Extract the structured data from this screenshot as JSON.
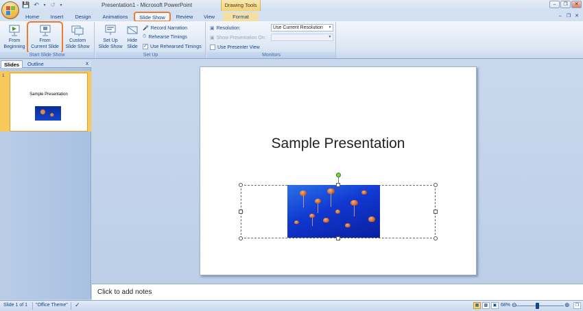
{
  "window": {
    "title": "Presentation1 - Microsoft PowerPoint",
    "contextual_title": "Drawing Tools"
  },
  "tabs": [
    "Home",
    "Insert",
    "Design",
    "Animations",
    "Slide Show",
    "Review",
    "View",
    "Format"
  ],
  "ribbon": {
    "start_group": {
      "label": "Start Slide Show",
      "from_beginning": "From\nBeginning",
      "from_current": "From\nCurrent Slide",
      "custom": "Custom\nSlide Show"
    },
    "setup_group": {
      "label": "Set Up",
      "setup_show": "Set Up\nSlide Show",
      "hide_slide": "Hide\nSlide",
      "record_narration": "Record Narration",
      "rehearse_timings": "Rehearse Timings",
      "use_rehearsed": "Use Rehearsed Timings"
    },
    "monitors_group": {
      "label": "Monitors",
      "resolution_label": "Resolution:",
      "resolution_value": "Use Current Resolution",
      "show_on_label": "Show Presentation On:",
      "presenter_view": "Use Presenter View"
    }
  },
  "panel": {
    "tab_slides": "Slides",
    "tab_outline": "Outline",
    "close": "x",
    "thumb_number": "1",
    "thumb_title": "Sample Presentation"
  },
  "slide": {
    "title": "Sample Presentation"
  },
  "notes": {
    "placeholder": "Click to add notes"
  },
  "status": {
    "slide_info": "Slide 1 of 1",
    "theme": "\"Office Theme\"",
    "zoom": "68%"
  }
}
